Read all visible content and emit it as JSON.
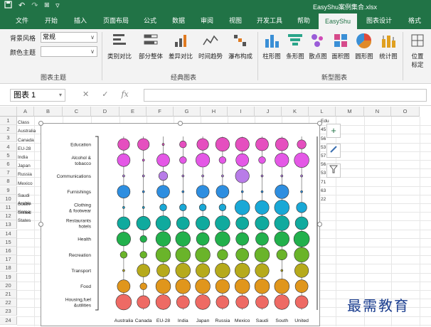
{
  "titlebar": {
    "filename": "EasyShu案例集合.xlsx",
    "qat_icons": [
      "save-icon",
      "undo-icon",
      "redo-icon",
      "camera-icon",
      "customize-icon"
    ]
  },
  "tabs": [
    {
      "label": "文件",
      "active": false
    },
    {
      "label": "开始",
      "active": false
    },
    {
      "label": "插入",
      "active": false
    },
    {
      "label": "页面布局",
      "active": false
    },
    {
      "label": "公式",
      "active": false
    },
    {
      "label": "数据",
      "active": false
    },
    {
      "label": "审阅",
      "active": false
    },
    {
      "label": "视图",
      "active": false
    },
    {
      "label": "开发工具",
      "active": false
    },
    {
      "label": "帮助",
      "active": false
    },
    {
      "label": "EasyShu",
      "active": true
    },
    {
      "label": "图表设计",
      "active": false
    },
    {
      "label": "格式",
      "active": false
    }
  ],
  "ribbon": {
    "theme_group": {
      "bg_style_label": "背景风格",
      "bg_style_value": "常规",
      "color_theme_label": "颜色主题",
      "color_theme_value": "",
      "group_label": "图表主题"
    },
    "classic_group": {
      "buttons": [
        "类别对比",
        "部分整体",
        "差异对比",
        "时间趋势",
        "瀑布构成"
      ],
      "group_label": "经典图表"
    },
    "new_group": {
      "buttons": [
        "柱形图",
        "条形图",
        "散点图",
        "面积图",
        "圆形图",
        "统计图"
      ],
      "group_label": "新型图表"
    },
    "extra": {
      "line1": "位置",
      "line2": "标定"
    }
  },
  "formula_bar": {
    "name_box": "图表 1",
    "fx": "fx",
    "formula": ""
  },
  "grid": {
    "columns": [
      "A",
      "B",
      "C",
      "D",
      "E",
      "F",
      "G",
      "H",
      "I",
      "J",
      "K",
      "L",
      "M",
      "N",
      "O"
    ],
    "rows": [
      "1",
      "2",
      "3",
      "4",
      "5",
      "6",
      "7",
      "8",
      "9",
      "10",
      "11",
      "12",
      "13",
      "14",
      "15",
      "16",
      "17",
      "18",
      "19",
      "20",
      "21",
      "22",
      "23",
      "24"
    ],
    "col_a_cells": [
      "Class",
      "Australia",
      "Canada",
      "EU-28",
      "India",
      "Japan",
      "Russia",
      "Mexico",
      "Saudi Arabia",
      "South Korea",
      "United States"
    ]
  },
  "chart_data": {
    "type": "scatter",
    "title": "",
    "xlabel": "",
    "ylabel": "",
    "categories_x": [
      "Australia",
      "Canada",
      "EU-28",
      "India",
      "Japan",
      "Russia",
      "Mexico",
      "Saudi Arabia",
      "South Korea",
      "United States"
    ],
    "tick_labels_x": [
      "Australia",
      "Canada",
      "EU-28",
      "India",
      "Japan",
      "Russia",
      "Mexico",
      "Saudi",
      "South",
      "United"
    ],
    "categories_y": [
      "Education",
      "Alcohol & tobacco",
      "Communications",
      "Furnishings",
      "Clothing & footwear",
      "Restaurants hotels",
      "Health",
      "Recreation",
      "Transport",
      "Food",
      "Housing,fuel &utilities"
    ],
    "tick_labels_y": [
      [
        "Education"
      ],
      [
        "Alcohol &",
        "tobacco"
      ],
      [
        "Communications"
      ],
      [
        "Furnishings"
      ],
      [
        "Clothing",
        "& footwear"
      ],
      [
        "Restaurants",
        "hotels"
      ],
      [
        "Health"
      ],
      [
        "Recreation"
      ],
      [
        "Transport"
      ],
      [
        "Food"
      ],
      [
        "Housing,fuel",
        "&utilities"
      ]
    ],
    "colors": [
      "#e54fbf",
      "#e458e6",
      "#b87ce8",
      "#2e8ee0",
      "#19a8d6",
      "#10aa9e",
      "#22b04c",
      "#6ab42a",
      "#b6aa1c",
      "#e0961c",
      "#ee6a64"
    ],
    "size_values": [
      [
        5,
        5,
        1,
        2,
        5,
        7,
        7,
        6,
        6,
        3
      ],
      [
        6,
        1,
        6,
        2,
        7,
        2,
        6,
        2,
        7,
        8
      ],
      [
        1,
        1,
        3,
        1,
        1,
        1,
        7,
        1,
        1,
        1
      ],
      [
        6,
        1,
        6,
        1,
        6,
        6,
        1,
        1,
        7,
        1
      ],
      [
        1,
        1,
        2,
        2,
        2,
        2,
        8,
        7,
        8,
        4
      ],
      [
        6,
        7,
        8,
        6,
        7,
        8,
        6,
        7,
        8,
        6
      ],
      [
        7,
        2,
        8,
        8,
        6,
        8,
        6,
        6,
        8,
        9
      ],
      [
        2,
        2,
        8,
        8,
        8,
        4,
        6,
        8,
        4,
        8
      ],
      [
        1,
        6,
        6,
        8,
        7,
        8,
        8,
        7,
        1,
        7
      ],
      [
        6,
        2,
        8,
        8,
        8,
        7,
        8,
        8,
        8,
        6
      ],
      [
        9,
        6,
        8,
        6,
        8,
        6,
        6,
        6,
        8,
        6
      ]
    ],
    "size_range": [
      1,
      9
    ],
    "grid": false,
    "legend": "none"
  },
  "watermark": "最需教育",
  "side_buttons": [
    "add-element-icon",
    "style-brush-icon",
    "filter-icon"
  ],
  "right_cells": [
    "Edu",
    "45",
    "56",
    "53",
    "57",
    "56",
    "53",
    "71",
    "63",
    "22"
  ]
}
